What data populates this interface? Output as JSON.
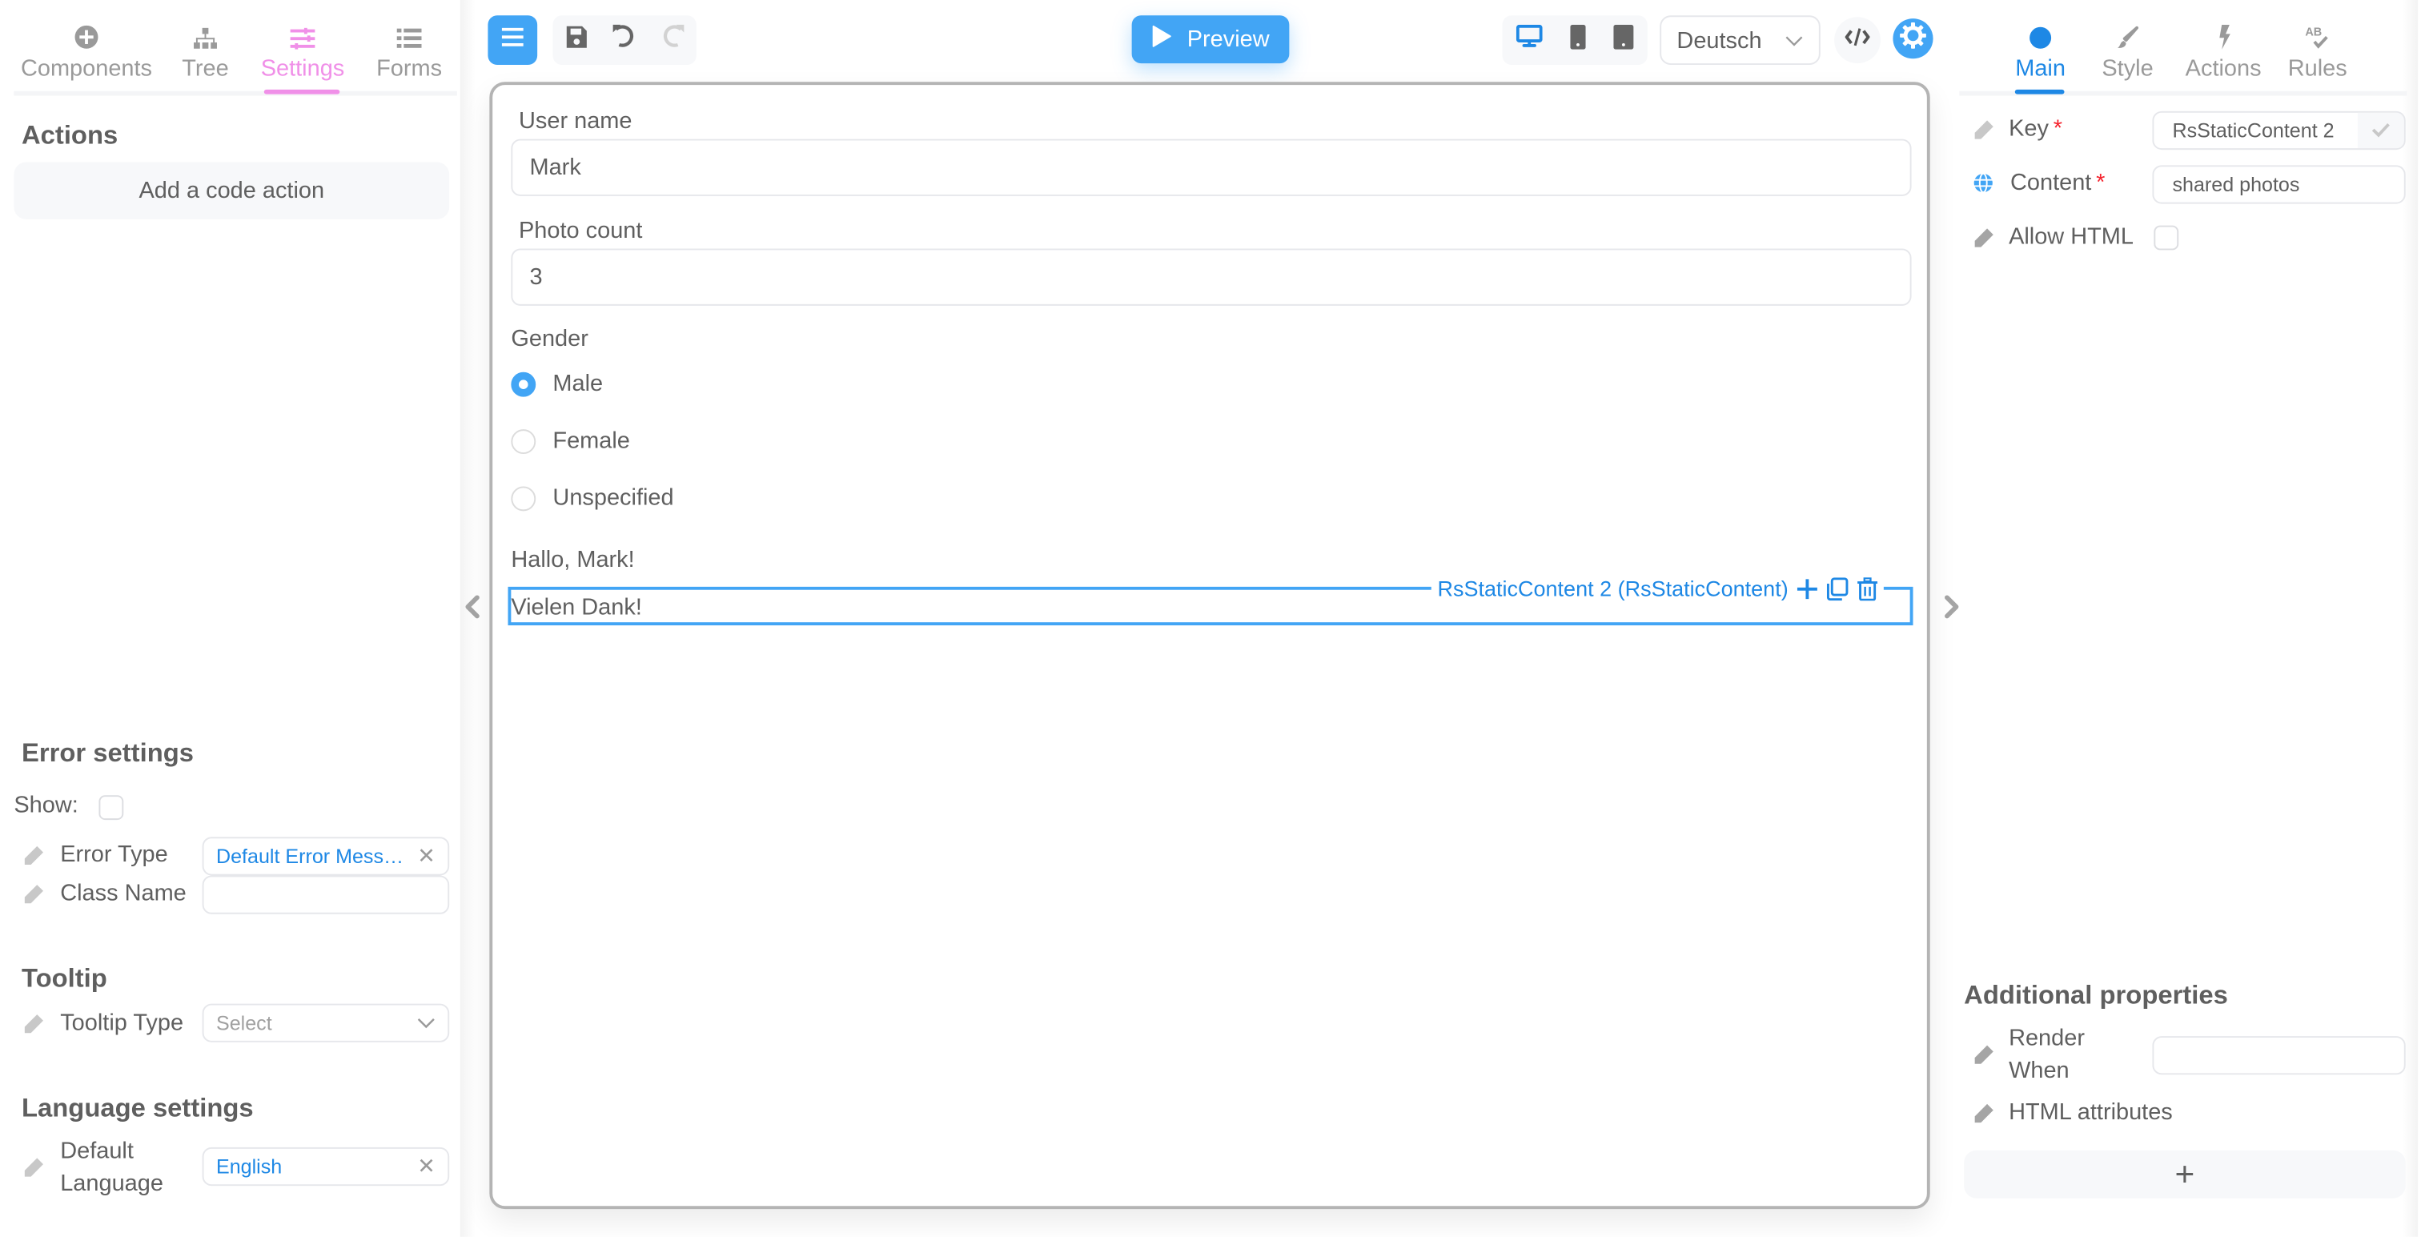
{
  "left_panel": {
    "tabs": [
      {
        "label": "Components",
        "icon": "plus-circle-icon",
        "active": false
      },
      {
        "label": "Tree",
        "icon": "sitemap-icon",
        "active": false
      },
      {
        "label": "Settings",
        "icon": "sliders-icon",
        "active": true
      },
      {
        "label": "Forms",
        "icon": "list-icon",
        "active": false
      }
    ],
    "actions": {
      "title": "Actions",
      "add_button": "Add a code action"
    },
    "error_settings": {
      "title": "Error settings",
      "show_label": "Show:",
      "show_checked": false,
      "error_type_label": "Error Type",
      "error_type_value": "Default Error Mess…",
      "class_name_label": "Class Name",
      "class_name_value": ""
    },
    "tooltip": {
      "title": "Tooltip",
      "type_label": "Tooltip Type",
      "type_placeholder": "Select"
    },
    "language": {
      "title": "Language settings",
      "default_label_line1": "Default",
      "default_label_line2": "Language",
      "default_value": "English"
    }
  },
  "toolbar": {
    "menu_icon": "hamburger-icon",
    "save_icon": "save-icon",
    "undo_icon": "undo-icon",
    "redo_icon": "redo-icon",
    "preview_label": "Preview",
    "devices": [
      {
        "name": "desktop",
        "active": true
      },
      {
        "name": "mobile",
        "active": false
      },
      {
        "name": "tablet",
        "active": false
      }
    ],
    "language_select": "Deutsch",
    "code_icon": "code-icon",
    "settings_icon": "gear-icon"
  },
  "canvas": {
    "fields": [
      {
        "label": "User name",
        "value": "Mark"
      },
      {
        "label": "Photo count",
        "value": "3"
      }
    ],
    "gender": {
      "label": "Gender",
      "options": [
        "Male",
        "Female",
        "Unspecified"
      ],
      "selected": "Male"
    },
    "greeting": "Hallo, Mark!",
    "selected_text": "Vielen Dank!",
    "selection_label": "RsStaticContent 2 (RsStaticContent)"
  },
  "right_panel": {
    "tabs": [
      {
        "label": "Main",
        "icon": "circle-icon",
        "active": true
      },
      {
        "label": "Style",
        "icon": "brush-icon",
        "active": false
      },
      {
        "label": "Actions",
        "icon": "bolt-icon",
        "active": false
      },
      {
        "label": "Rules",
        "icon": "spellcheck-icon",
        "active": false
      }
    ],
    "key_label": "Key",
    "key_value": "RsStaticContent 2",
    "content_label": "Content",
    "content_value": "shared photos",
    "allow_html_label": "Allow HTML",
    "allow_html_checked": false,
    "additional": {
      "title": "Additional properties",
      "render_when_line1": "Render",
      "render_when_line2": "When",
      "render_when_value": "",
      "html_attributes_label": "HTML attributes",
      "add_label": "+"
    }
  },
  "colors": {
    "accent_blue": "#42a5f5",
    "link_blue": "#1e88e5",
    "settings_pink": "#f090e8",
    "required_red": "#f5222d"
  }
}
